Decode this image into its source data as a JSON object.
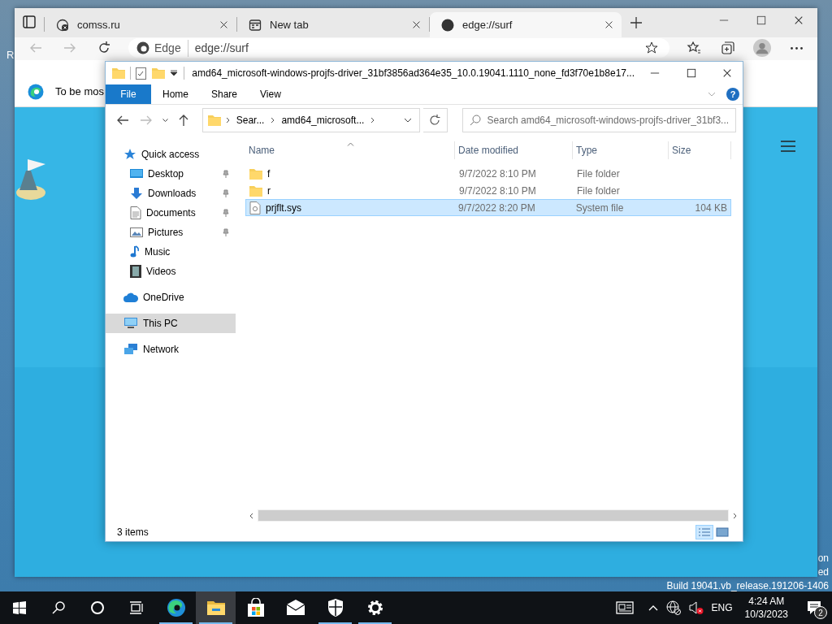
{
  "desktop": {
    "icon_label": "R",
    "watermark": [
      "on",
      "ed",
      "Build 19041.vb_release.191206-1406"
    ]
  },
  "browser": {
    "tabs": [
      {
        "label": "comss.ru",
        "kind": "blocked",
        "selected": false
      },
      {
        "label": "New tab",
        "kind": "newtab",
        "selected": false
      },
      {
        "label": "edge://surf",
        "kind": "surf",
        "selected": true
      }
    ],
    "address": {
      "site": "Edge",
      "url": "edge://surf"
    },
    "info_bar": {
      "text": "To be mos"
    }
  },
  "explorer": {
    "title": "amd64_microsoft-windows-projfs-driver_31bf3856ad364e35_10.0.19041.1110_none_fd3f70e1b8e17...",
    "ribbon": {
      "file": "File",
      "tabs": [
        "Home",
        "Share",
        "View"
      ],
      "help": "?"
    },
    "breadcrumbs": [
      "Sear...",
      "amd64_microsoft..."
    ],
    "search": {
      "placeholder": "Search amd64_microsoft-windows-projfs-driver_31bf3..."
    },
    "navigation": [
      {
        "label": "Quick access",
        "kind": "star",
        "selected": false,
        "children": [
          {
            "label": "Desktop",
            "kind": "desktop",
            "pinned": true,
            "selected": false
          },
          {
            "label": "Downloads",
            "kind": "downloads",
            "pinned": true,
            "selected": false
          },
          {
            "label": "Documents",
            "kind": "documents",
            "pinned": true,
            "selected": false
          },
          {
            "label": "Pictures",
            "kind": "pictures",
            "pinned": true,
            "selected": false
          },
          {
            "label": "Music",
            "kind": "music",
            "pinned": false,
            "selected": false
          },
          {
            "label": "Videos",
            "kind": "videos",
            "pinned": false,
            "selected": false
          }
        ]
      },
      {
        "label": "OneDrive",
        "kind": "cloud",
        "selected": false
      },
      {
        "label": "This PC",
        "kind": "pc",
        "selected": true
      },
      {
        "label": "Network",
        "kind": "network",
        "selected": false
      }
    ],
    "columns": [
      {
        "label": "Name",
        "sorted": true
      },
      {
        "label": "Date modified",
        "sorted": false
      },
      {
        "label": "Type",
        "sorted": false
      },
      {
        "label": "Size",
        "sorted": false
      }
    ],
    "rows": [
      {
        "name": "f",
        "kind": "folder",
        "date": "9/7/2022 8:10 PM",
        "type": "File folder",
        "selected": false
      },
      {
        "name": "r",
        "kind": "folder",
        "date": "9/7/2022 8:10 PM",
        "type": "File folder",
        "selected": false
      },
      {
        "name": "prjflt.sys",
        "kind": "file",
        "date": "9/7/2022 8:20 PM",
        "type": "System file",
        "size": "104 KB",
        "selected": true
      }
    ],
    "status": "3 items",
    "views": [
      {
        "kind": "details",
        "selected": true
      },
      {
        "kind": "large_icons",
        "selected": false
      }
    ]
  },
  "taskbar": {
    "apps": [
      {
        "kind": "edge",
        "running": true,
        "active": false
      },
      {
        "kind": "explorer",
        "running": true,
        "active": true
      },
      {
        "kind": "store",
        "running": false,
        "active": false
      },
      {
        "kind": "mail",
        "running": false,
        "active": false
      },
      {
        "kind": "security",
        "running": true,
        "active": false
      },
      {
        "kind": "settings",
        "running": true,
        "active": false
      }
    ],
    "tray": {
      "muted": true,
      "language": "ENG",
      "time": "4:24 AM",
      "date": "10/3/2023",
      "notifications": "2"
    }
  }
}
